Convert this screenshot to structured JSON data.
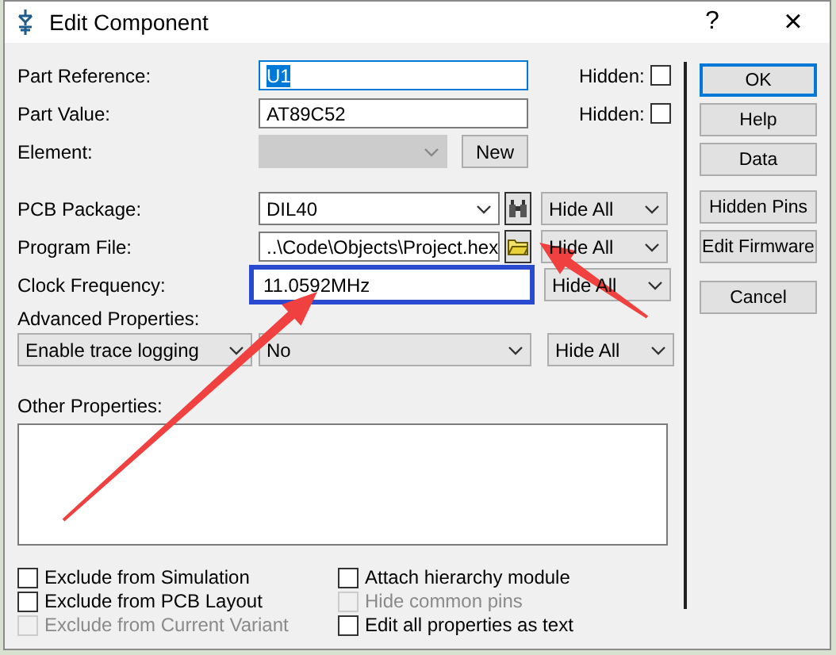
{
  "window": {
    "title": "Edit Component",
    "help": "?",
    "close": "×"
  },
  "rows": [
    {
      "kind": "text",
      "label": "Part Reference:",
      "value": "U1",
      "highlighted": true,
      "focused": true,
      "hidden_label": "Hidden:",
      "hidden": false
    },
    {
      "kind": "text",
      "label": "Part Value:",
      "value": "AT89C52",
      "highlighted": false,
      "focused": false,
      "hidden_label": "Hidden:",
      "hidden": false
    },
    {
      "kind": "element",
      "label": "Element:",
      "disabled": true,
      "button": "New"
    },
    {
      "kind": "package",
      "label": "PCB Package:",
      "value": "DIL40",
      "visibility": "Hide All"
    },
    {
      "kind": "file",
      "label": "Program File:",
      "value": "..\\Code\\Objects\\Project.hex",
      "visibility": "Hide All"
    },
    {
      "kind": "boxed",
      "label": "Clock Frequency:",
      "value": "11.0592MHz",
      "visibility": "Hide All"
    }
  ],
  "advanced": {
    "label": "Advanced Properties:",
    "property": "Enable trace logging",
    "value": "No",
    "visibility": "Hide All"
  },
  "other": {
    "label": "Other Properties:"
  },
  "checkboxes_left": [
    {
      "label": "Exclude from Simulation",
      "checked": false,
      "disabled": false
    },
    {
      "label": "Exclude from PCB Layout",
      "checked": false,
      "disabled": false
    },
    {
      "label": "Exclude from Current Variant",
      "checked": false,
      "disabled": true
    }
  ],
  "checkboxes_right": [
    {
      "label": "Attach hierarchy module",
      "checked": false,
      "disabled": false
    },
    {
      "label": "Hide common pins",
      "checked": false,
      "disabled": true
    },
    {
      "label": "Edit all properties as text",
      "checked": false,
      "disabled": false
    }
  ],
  "buttons": [
    {
      "label": "OK",
      "default": true
    },
    {
      "label": "Help",
      "default": false
    },
    {
      "label": "Data",
      "default": false
    },
    {
      "label": "Hidden Pins",
      "default": false
    },
    {
      "label": "Edit Firmware",
      "default": false
    },
    {
      "label": "Cancel",
      "default": false
    }
  ]
}
